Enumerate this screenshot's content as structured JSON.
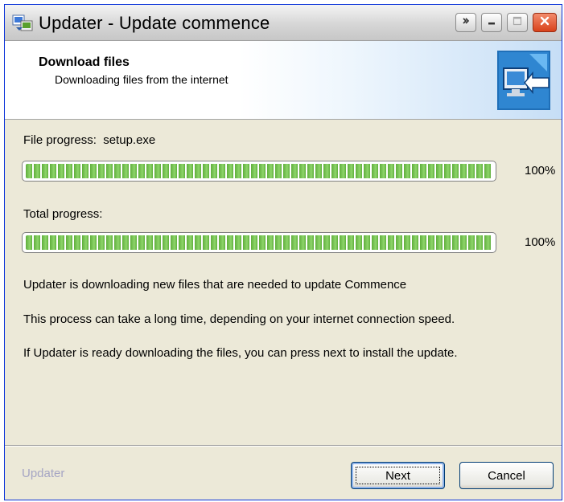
{
  "window": {
    "title": "Updater - Update commence"
  },
  "header": {
    "title": "Download files",
    "subtitle": "Downloading files from the internet"
  },
  "file_progress": {
    "label": "File progress:",
    "file": "setup.exe",
    "value": 1.0,
    "percent_text": "100%"
  },
  "total_progress": {
    "label": "Total progress:",
    "value": 1.0,
    "percent_text": "100%"
  },
  "messages": [
    "Updater is downloading new files that are needed to update Commence",
    "This process can take a long time, depending on your internet connection speed.",
    "If Updater is ready downloading the files, you can press next to install the update."
  ],
  "footer": {
    "brand": "Updater",
    "next_label": "Next",
    "cancel_label": "Cancel"
  },
  "icons": {
    "app": "updater-app-icon",
    "header": "computer-download-icon",
    "title_buttons": [
      "context-help-icon",
      "minimize-icon",
      "maximize-icon",
      "close-icon"
    ]
  },
  "colors": {
    "progress_fill": "#5fae3c",
    "close_button": "#d8421a",
    "brand_text": "#a5a5c4"
  }
}
